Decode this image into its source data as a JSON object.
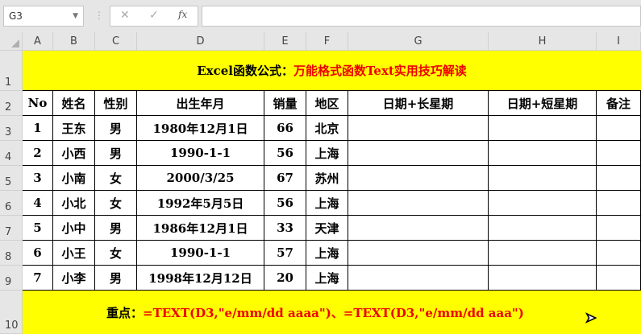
{
  "formula_bar": {
    "name_box": "G3",
    "cancel": "✕",
    "enter": "✓",
    "fx": "fx",
    "value": ""
  },
  "columns": [
    "A",
    "B",
    "C",
    "D",
    "E",
    "F",
    "G",
    "H",
    "I"
  ],
  "rows": [
    "1",
    "2",
    "3",
    "4",
    "5",
    "6",
    "7",
    "8",
    "9",
    "10"
  ],
  "title": {
    "black": "Excel函数公式：",
    "red": "万能格式函数Text实用技巧解读"
  },
  "headers": [
    "No",
    "姓名",
    "性别",
    "出生年月",
    "销量",
    "地区",
    "日期+长星期",
    "日期+短星期",
    "备注"
  ],
  "data": [
    [
      "1",
      "王东",
      "男",
      "1980年12月1日",
      "66",
      "北京",
      "",
      "",
      ""
    ],
    [
      "2",
      "小西",
      "男",
      "1990-1-1",
      "56",
      "上海",
      "",
      "",
      ""
    ],
    [
      "3",
      "小南",
      "女",
      "2000/3/25",
      "67",
      "苏州",
      "",
      "",
      ""
    ],
    [
      "4",
      "小北",
      "女",
      "1992年5月5日",
      "56",
      "上海",
      "",
      "",
      ""
    ],
    [
      "5",
      "小中",
      "男",
      "1986年12月1日",
      "33",
      "天津",
      "",
      "",
      ""
    ],
    [
      "6",
      "小王",
      "女",
      "1990-1-1",
      "57",
      "上海",
      "",
      "",
      ""
    ],
    [
      "7",
      "小李",
      "男",
      "1998年12月12日",
      "20",
      "上海",
      "",
      "",
      ""
    ]
  ],
  "note": {
    "label": "重点：",
    "formula": "=TEXT(D3,\"e/mm/dd aaaa\")、=TEXT(D3,\"e/mm/dd aaa\")"
  }
}
